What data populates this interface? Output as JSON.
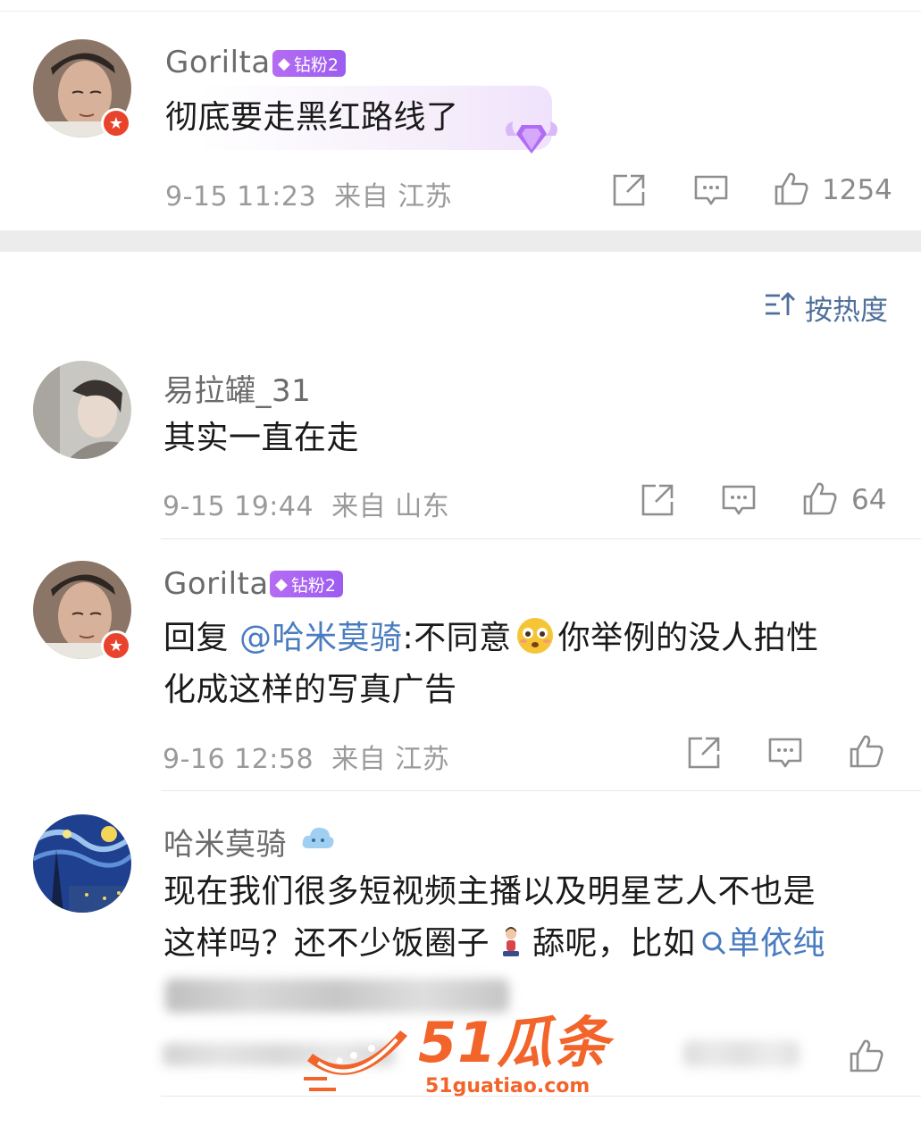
{
  "comments": [
    {
      "username": "Gorilta",
      "fan_badge": "钻粉2",
      "text": "彻底要走黑红路线了",
      "time": "9-15 11:23",
      "location": "来自 江苏",
      "likes": "1254"
    },
    {
      "username": "易拉罐_31",
      "text": "其实一直在走",
      "time": "9-15 19:44",
      "location": "来自 山东",
      "likes": "64"
    },
    {
      "username": "Gorilta",
      "fan_badge": "钻粉2",
      "reply_prefix": "回复 ",
      "mention": "@哈米莫骑",
      "text_line1_a": ":不同意",
      "text_line1_b": "你举例的没人拍性",
      "text_line2": "化成这样的写真广告",
      "time": "9-16 12:58",
      "location": "来自 江苏"
    },
    {
      "username": "哈米莫骑",
      "text_line1": "现在我们很多短视频主播以及明星艺人不也是",
      "text_line2_a": "这样吗？还不少饭圈子",
      "text_line2_b": "舔呢，比如",
      "search_link": "单依纯"
    }
  ],
  "sort": {
    "label": "按热度"
  },
  "watermark": {
    "brand": "51瓜条",
    "url": "51guatiao.com"
  },
  "colors": {
    "link": "#4a7cc0",
    "badge": "#a862f1",
    "verified": "#e8432d",
    "watermark": "#f2642a"
  },
  "icons": [
    "share-icon",
    "comment-icon",
    "like-icon",
    "sort-icon",
    "search-icon",
    "verified-icon",
    "gem-icon",
    "cloud-icon"
  ]
}
